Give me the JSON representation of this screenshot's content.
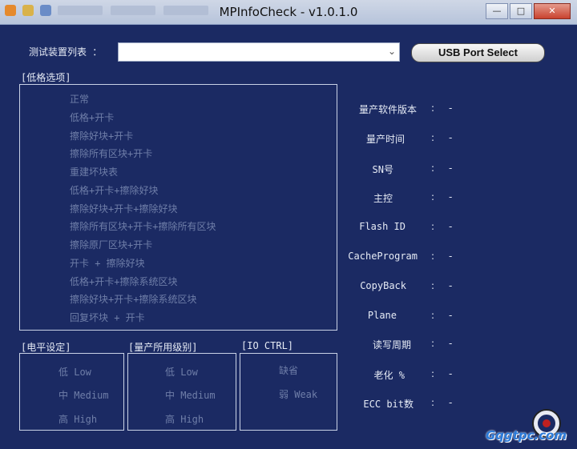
{
  "window": {
    "title": "MPInfoCheck - v1.0.1.0",
    "buttons": {
      "minimize": "—",
      "maximize": "□",
      "close": "✕"
    }
  },
  "device": {
    "label": "测试装置列表 ：",
    "selected": "",
    "usb_button": "USB Port Select"
  },
  "format": {
    "title": "[低格选项]",
    "options": [
      "正常",
      "低格+开卡",
      "擦除好块+开卡",
      "擦除所有区块+开卡",
      "重建坏块表",
      "低格+开卡+擦除好块",
      "擦除好块+开卡+擦除好块",
      "擦除所有区块+开卡+擦除所有区块",
      "擦除原厂区块+开卡",
      "开卡 + 擦除好块",
      "低格+开卡+擦除系统区块",
      "擦除好块+开卡+擦除系统区块",
      "回复坏块 + 开卡"
    ]
  },
  "voltage": {
    "title": "[电平设定]",
    "options": [
      "低 Low",
      "中 Medium",
      "高 High"
    ]
  },
  "level": {
    "title": "[量产所用级别]",
    "options": [
      "低 Low",
      "中 Medium",
      "高 High"
    ]
  },
  "io": {
    "title": "[IO CTRL]",
    "options": [
      "缺省",
      "弱 Weak"
    ]
  },
  "info": [
    {
      "label": "量产软件版本",
      "value": "-"
    },
    {
      "label": "量产时间",
      "value": "-"
    },
    {
      "label": "SN号",
      "value": "-"
    },
    {
      "label": "主控",
      "value": "-"
    },
    {
      "label": "Flash ID",
      "value": "-"
    },
    {
      "label": "CacheProgram",
      "value": "-"
    },
    {
      "label": "CopyBack",
      "value": "-"
    },
    {
      "label": "Plane",
      "value": "-"
    },
    {
      "label": "读写周期",
      "value": "-"
    },
    {
      "label": "老化 %",
      "value": "-"
    },
    {
      "label": "ECC bit数",
      "value": "-"
    }
  ],
  "info_colon": ":",
  "watermark": {
    "text": "Gqgtpc.com"
  }
}
